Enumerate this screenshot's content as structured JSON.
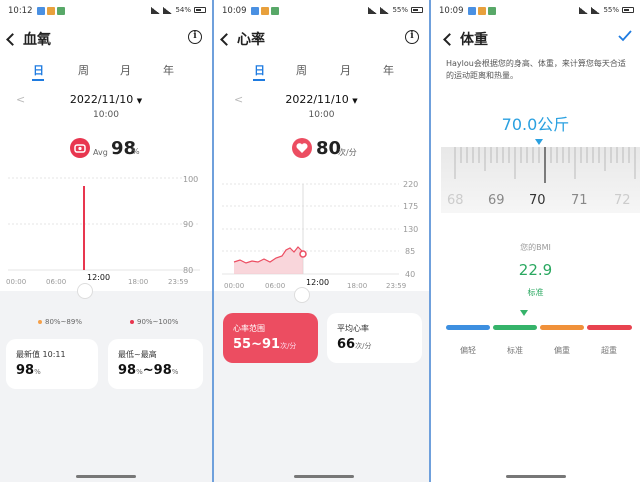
{
  "screens": {
    "spo2": {
      "status": {
        "time": "10:12",
        "battery": "54%"
      },
      "title": "血氧",
      "tabs": [
        "日",
        "周",
        "月",
        "年"
      ],
      "date": "2022/11/10",
      "time_label": "10:00",
      "avg_label": "Avg",
      "avg_value": "98",
      "avg_unit": "%",
      "y_ticks": [
        "100",
        "90",
        "80"
      ],
      "x_ticks": [
        "00:00",
        "06:00",
        "12:00",
        "18:00",
        "23:59"
      ],
      "legend": [
        "80%~89%",
        "90%~100%"
      ],
      "latest_label": "最新值 10:11",
      "latest_value": "98",
      "latest_unit": "%",
      "range_label": "最低~最高",
      "range_low": "98",
      "range_high": "98",
      "range_sep": "~",
      "range_unit": "%",
      "colors": {
        "accent": "#e8364f",
        "orange": "#f5a04a",
        "tab": "#1e7be0"
      }
    },
    "heart": {
      "status": {
        "time": "10:09",
        "battery": "55%"
      },
      "title": "心率",
      "tabs": [
        "日",
        "周",
        "月",
        "年"
      ],
      "date": "2022/11/10",
      "time_label": "10:00",
      "value": "80",
      "unit": "次/分",
      "y_ticks": [
        "220",
        "175",
        "130",
        "85",
        "40"
      ],
      "x_ticks": [
        "00:00",
        "06:00",
        "12:00",
        "18:00",
        "23:59"
      ],
      "range_card_label": "心率范围",
      "range_card_value": "55~91",
      "range_card_unit": "次/分",
      "avg_card_label": "平均心率",
      "avg_card_value": "66",
      "avg_card_unit": "次/分",
      "colors": {
        "accent": "#ec4d61"
      }
    },
    "weight": {
      "status": {
        "time": "10:09",
        "battery": "55%"
      },
      "title": "体重",
      "description": "Haylou会根据您的身高、体重，来计算您每天合适的运动距离和热量。",
      "value": "70.0公斤",
      "ruler_ticks": [
        "68",
        "69",
        "70",
        "71",
        "72"
      ],
      "bmi_label": "您的BMI",
      "bmi_value": "22.9",
      "bmi_status": "标准",
      "bmi_categories": [
        "偏轻",
        "标准",
        "偏重",
        "超重"
      ],
      "colors": {
        "accent": "#2aa0e0",
        "bmi_value": "#2aa860",
        "seg_blue": "#3d8fe0",
        "seg_green": "#35b36a",
        "seg_orange": "#f0913a",
        "seg_red": "#e8434f"
      }
    }
  }
}
